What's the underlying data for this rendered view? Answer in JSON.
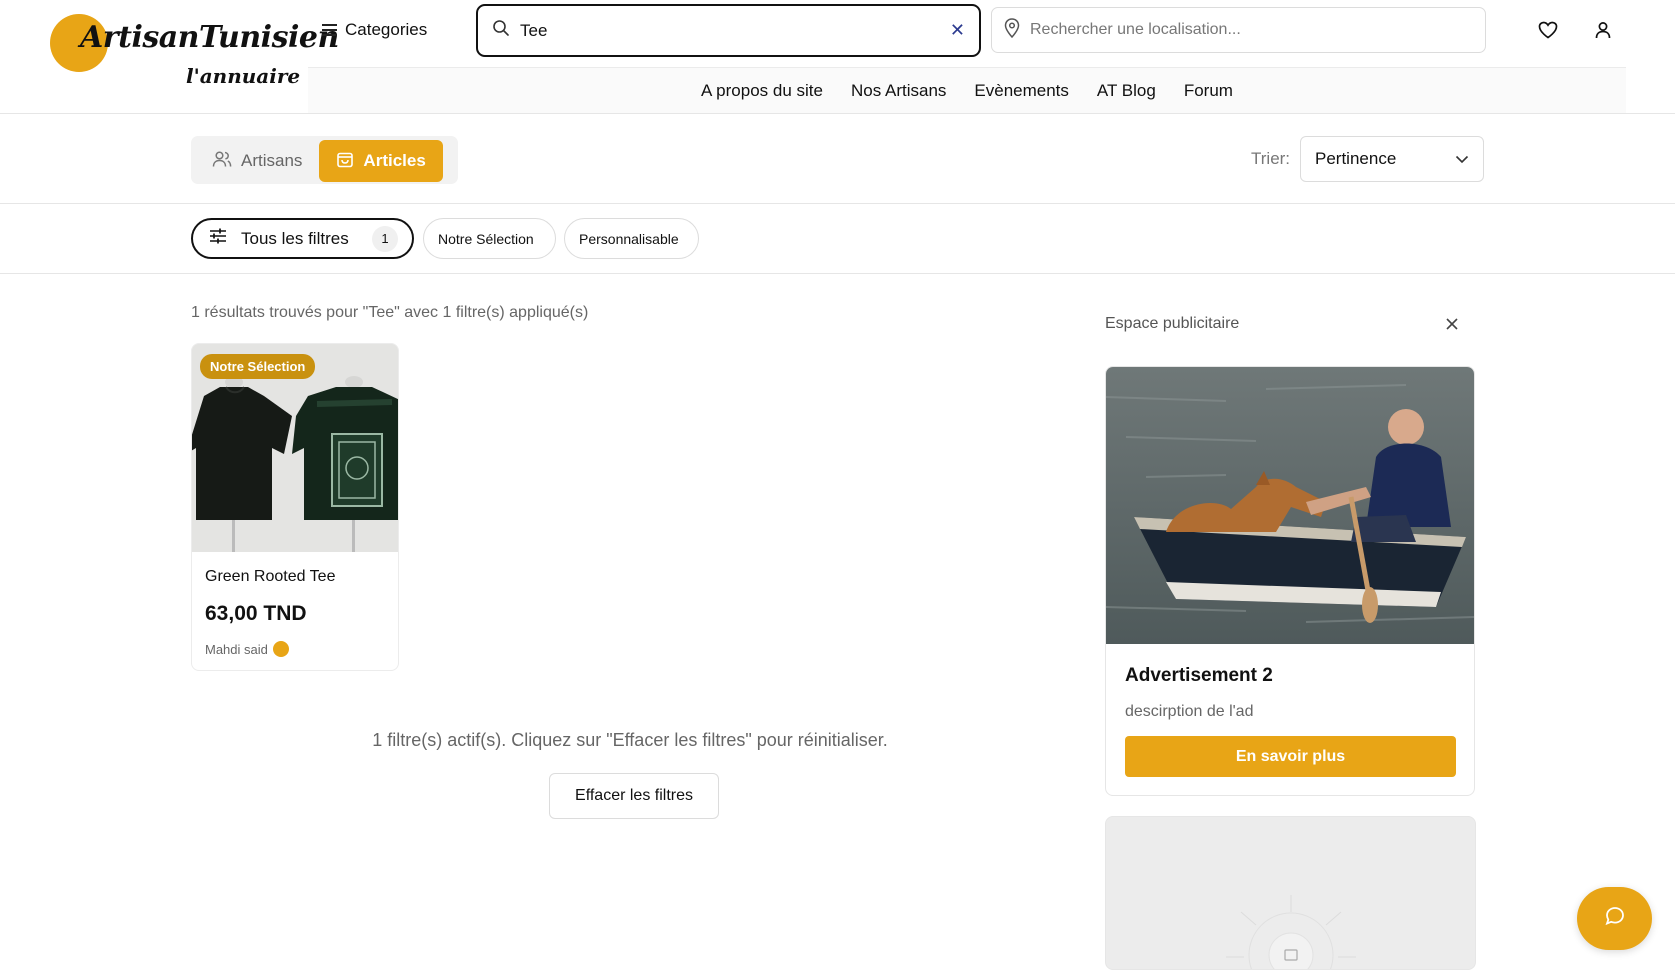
{
  "brand": {
    "name": "ArtisanTunisien",
    "tagline": "l'annuaire"
  },
  "header": {
    "categories_label": "Categories",
    "search_value": "Tee",
    "location_placeholder": "Rechercher une localisation...",
    "nav": [
      "A propos du site",
      "Nos Artisans",
      "Evènements",
      "AT Blog",
      "Forum"
    ]
  },
  "tabs": [
    {
      "label": "Artisans",
      "icon": "users-icon",
      "active": false
    },
    {
      "label": "Articles",
      "icon": "shopping-bag-icon",
      "active": true
    }
  ],
  "sort": {
    "label": "Trier:",
    "value": "Pertinence"
  },
  "filters": {
    "all_label": "Tous les filtres",
    "count": "1",
    "chips": [
      "Notre Sélection",
      "Personnalisable"
    ]
  },
  "results": {
    "summary": "1 résultats trouvés pour \"Tee\" avec 1 filtre(s) appliqué(s)",
    "items": [
      {
        "badge": "Notre Sélection",
        "title": "Green Rooted Tee",
        "price": "63,00 TND",
        "seller": "Mahdi said"
      }
    ],
    "active_filters_info": "1 filtre(s) actif(s). Cliquez sur \"Effacer les filtres\" pour réinitialiser.",
    "clear_label": "Effacer les filtres"
  },
  "ad": {
    "heading": "Espace publicitaire",
    "title": "Advertisement 2",
    "description": "descirption de l'ad",
    "button": "En savoir plus"
  },
  "colors": {
    "accent": "#e8a516",
    "badge": "#c9910f",
    "clear_x": "#2b3a8f"
  }
}
